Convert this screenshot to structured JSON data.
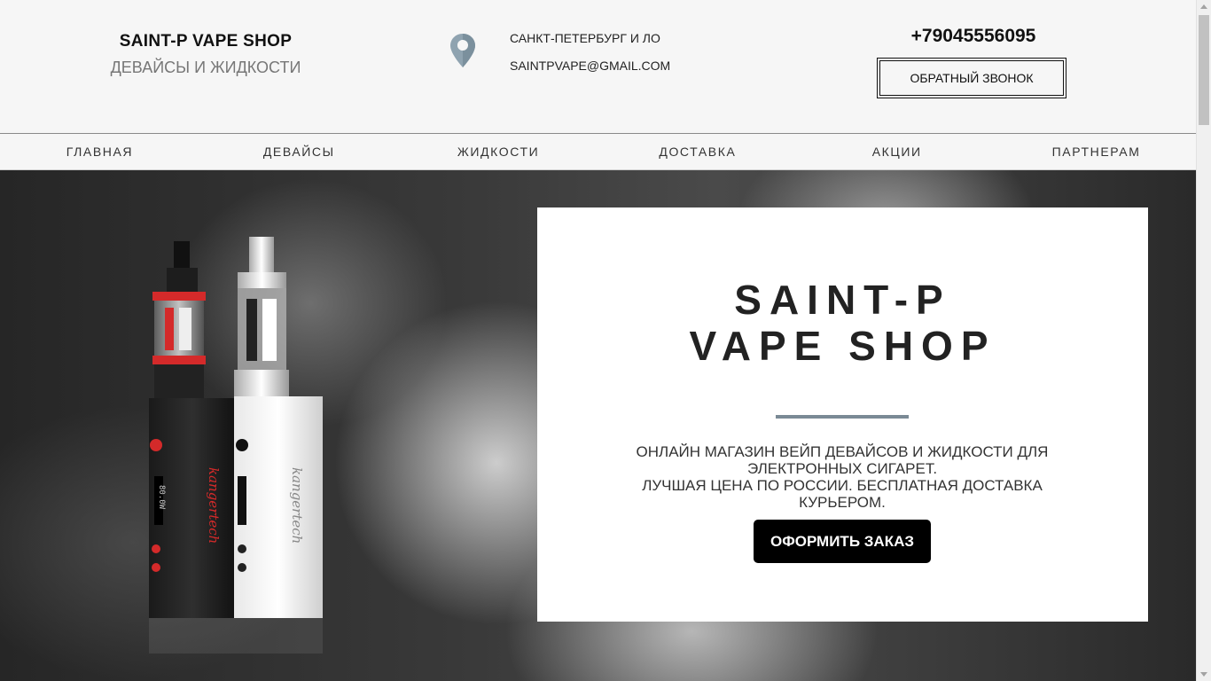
{
  "header": {
    "brand_name": "SAINT-P VAPE SHOP",
    "brand_tagline": "ДЕВАЙСЫ И ЖИДКОСТИ",
    "location": "САНКТ-ПЕТЕРБУРГ И ЛО",
    "email": "SAINTPVAPE@GMAIL.COM",
    "phone": "+79045556095",
    "callback_label": "ОБРАТНЫЙ ЗВОНОК",
    "location_icon": "map-pin-icon"
  },
  "nav": {
    "items": [
      {
        "label": "ГЛАВНАЯ"
      },
      {
        "label": "ДЕВАЙСЫ"
      },
      {
        "label": "ЖИДКОСТИ"
      },
      {
        "label": "ДОСТАВКА"
      },
      {
        "label": "АКЦИИ"
      },
      {
        "label": "ПАРТНЕРАМ"
      }
    ]
  },
  "hero": {
    "device_text_1": "kangertech",
    "device_text_2": "kangertech",
    "screen_text": "80.0W",
    "title_line1": "SAINT-P",
    "title_line2": "VAPE SHOP",
    "description_line1": "ОНЛАЙН МАГАЗИН ВЕЙП ДЕВАЙСОВ И ЖИДКОСТИ ДЛЯ ЭЛЕКТРОННЫХ СИГАРЕТ.",
    "description_line2": "ЛУЧШАЯ ЦЕНА ПО РОССИИ. БЕСПЛАТНАЯ ДОСТАВКА КУРЬЕРОМ.",
    "order_button": "ОФОРМИТЬ ЗАКАЗ"
  },
  "colors": {
    "accent_divider": "#7a8a95",
    "pin": "#8fa3b0",
    "button_bg": "#000000",
    "device_red": "#d42a2a"
  }
}
